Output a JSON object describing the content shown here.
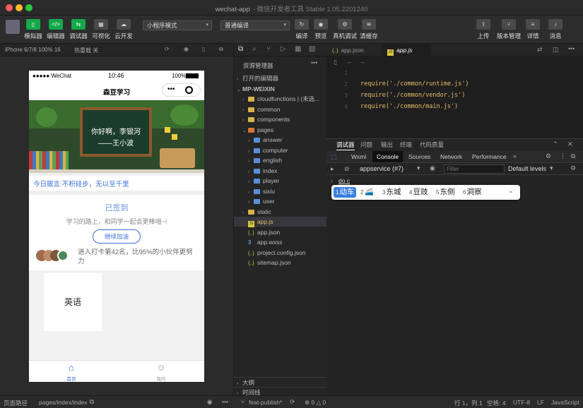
{
  "window": {
    "title": "wechat-app",
    "subtitle": "- 微信开发者工具 Stable 1.05.2201240"
  },
  "toolbar": {
    "simulator": "模拟器",
    "editor": "编辑器",
    "debugger": "调试器",
    "visual": "可视化",
    "cloud": "云开发",
    "mode_select": "小程序模式",
    "compile_select": "普通编译",
    "compile": "编译",
    "preview": "预览",
    "real_debug": "真机调试",
    "clear_cache": "清缓存",
    "upload": "上传",
    "version": "版本管理",
    "details": "详情",
    "messages": "消息"
  },
  "simbar": {
    "device": "iPhone 6/7/8 100% 16",
    "hotreload": "热重载 关"
  },
  "phone": {
    "status": {
      "carrier": "●●●●● WeChat",
      "time": "10:46",
      "battery": "100%"
    },
    "nav_title": "森豆学习",
    "banner": {
      "line1": "你好啊，李银河",
      "line2": "——王小波"
    },
    "motto": "今日箴言:不积硅步，无以至千里",
    "signed": "已签到",
    "encourage": "学习的路上，和同学一起会更棒哦~!",
    "cheer_btn": "继续加油",
    "rank": "进入打卡第42名，比95%的小伙伴更努力",
    "card": "英语",
    "tab_home": "首页",
    "tab_me": "我的"
  },
  "explorer": {
    "header": "资源管理器",
    "open_editors": "打开的编辑器",
    "project": "MP-WEIXIN",
    "items": [
      "cloudfunctions | (未选...",
      "common",
      "components",
      "pages",
      "answer",
      "computer",
      "english",
      "index",
      "player",
      "sixiu",
      "user",
      "static",
      "app.js",
      "app.json",
      "app.wxss",
      "project.config.json",
      "sitemap.json"
    ],
    "outline": "大纲",
    "timeline": "时间线"
  },
  "editor": {
    "tabs": [
      "app.json",
      "app.js"
    ],
    "lines": [
      "",
      "require('./common/runtime.js')",
      "require('./common/vendor.js')",
      "require('./common/main.js')"
    ],
    "line_numbers": [
      "1",
      "2",
      "3",
      "4"
    ]
  },
  "devtools": {
    "tabs": [
      "调试器",
      "问题",
      "输出",
      "终端",
      "代码质量"
    ],
    "panels": [
      "Wxml",
      "Console",
      "Sources",
      "Network",
      "Performance"
    ],
    "context": "appservice (#7)",
    "filter_placeholder": "Filter",
    "levels": "Default levels",
    "input": "do  c",
    "candidates": [
      "动车",
      "🚄",
      "东城",
      "豆豉",
      "东侧",
      "洞察"
    ],
    "candidate_nums": [
      "1",
      "2",
      "3",
      "4",
      "5",
      "6"
    ]
  },
  "status": {
    "path_label": "页面路径",
    "path": "pages/index/index",
    "branch": "feat-publish*",
    "errors": "⊗ 0 △ 0",
    "position": "行 1，列 1",
    "spaces": "空格: 4",
    "encoding": "UTF-8",
    "eol": "LF",
    "language": "JavaScript"
  },
  "colors": {
    "accent_green": "#15a84a",
    "link_blue": "#3a6fd8",
    "signed_blue": "#6a8fe0"
  }
}
